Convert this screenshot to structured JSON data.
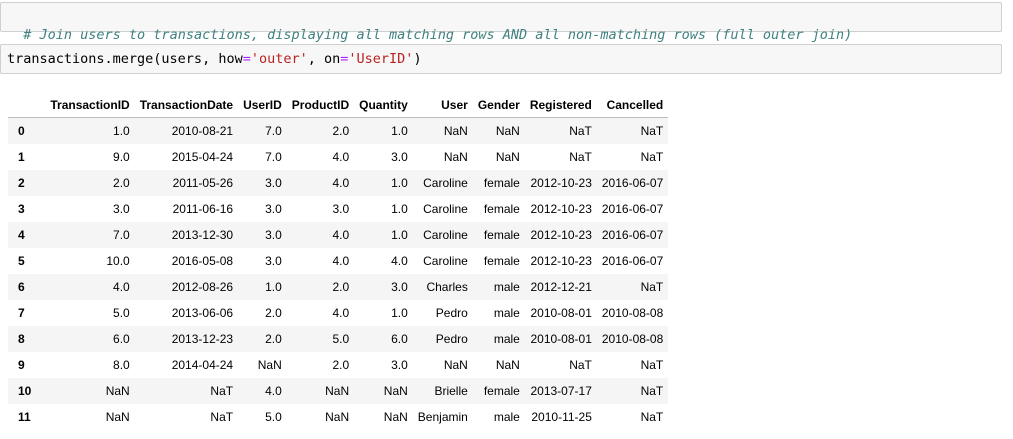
{
  "comment_cell": {
    "text": "# Join users to transactions, displaying all matching rows AND all non-matching rows (full outer join)"
  },
  "code_cell": {
    "tokens": [
      {
        "text": "transactions.merge(users, how",
        "kind": "plain"
      },
      {
        "text": "=",
        "kind": "op"
      },
      {
        "text": "'outer'",
        "kind": "str"
      },
      {
        "text": ", on",
        "kind": "plain"
      },
      {
        "text": "=",
        "kind": "op"
      },
      {
        "text": "'UserID'",
        "kind": "str"
      },
      {
        "text": ")",
        "kind": "plain"
      }
    ]
  },
  "colors": {
    "comment": "#408080",
    "operator": "#aa22ff",
    "string": "#ba2121",
    "cell_background": "#f7f7f7",
    "cell_border": "#cfcfcf",
    "row_stripe": "#f5f5f5"
  },
  "dataframe": {
    "columns": [
      "",
      "TransactionID",
      "TransactionDate",
      "UserID",
      "ProductID",
      "Quantity",
      "User",
      "Gender",
      "Registered",
      "Cancelled"
    ],
    "rows": [
      [
        "0",
        "1.0",
        "2010-08-21",
        "7.0",
        "2.0",
        "1.0",
        "NaN",
        "NaN",
        "NaT",
        "NaT"
      ],
      [
        "1",
        "9.0",
        "2015-04-24",
        "7.0",
        "4.0",
        "3.0",
        "NaN",
        "NaN",
        "NaT",
        "NaT"
      ],
      [
        "2",
        "2.0",
        "2011-05-26",
        "3.0",
        "4.0",
        "1.0",
        "Caroline",
        "female",
        "2012-10-23",
        "2016-06-07"
      ],
      [
        "3",
        "3.0",
        "2011-06-16",
        "3.0",
        "3.0",
        "1.0",
        "Caroline",
        "female",
        "2012-10-23",
        "2016-06-07"
      ],
      [
        "4",
        "7.0",
        "2013-12-30",
        "3.0",
        "4.0",
        "1.0",
        "Caroline",
        "female",
        "2012-10-23",
        "2016-06-07"
      ],
      [
        "5",
        "10.0",
        "2016-05-08",
        "3.0",
        "4.0",
        "4.0",
        "Caroline",
        "female",
        "2012-10-23",
        "2016-06-07"
      ],
      [
        "6",
        "4.0",
        "2012-08-26",
        "1.0",
        "2.0",
        "3.0",
        "Charles",
        "male",
        "2012-12-21",
        "NaT"
      ],
      [
        "7",
        "5.0",
        "2013-06-06",
        "2.0",
        "4.0",
        "1.0",
        "Pedro",
        "male",
        "2010-08-01",
        "2010-08-08"
      ],
      [
        "8",
        "6.0",
        "2013-12-23",
        "2.0",
        "5.0",
        "6.0",
        "Pedro",
        "male",
        "2010-08-01",
        "2010-08-08"
      ],
      [
        "9",
        "8.0",
        "2014-04-24",
        "NaN",
        "2.0",
        "3.0",
        "NaN",
        "NaN",
        "NaT",
        "NaT"
      ],
      [
        "10",
        "NaN",
        "NaT",
        "4.0",
        "NaN",
        "NaN",
        "Brielle",
        "female",
        "2013-07-17",
        "NaT"
      ],
      [
        "11",
        "NaN",
        "NaT",
        "5.0",
        "NaN",
        "NaN",
        "Benjamin",
        "male",
        "2010-11-25",
        "NaT"
      ]
    ]
  }
}
